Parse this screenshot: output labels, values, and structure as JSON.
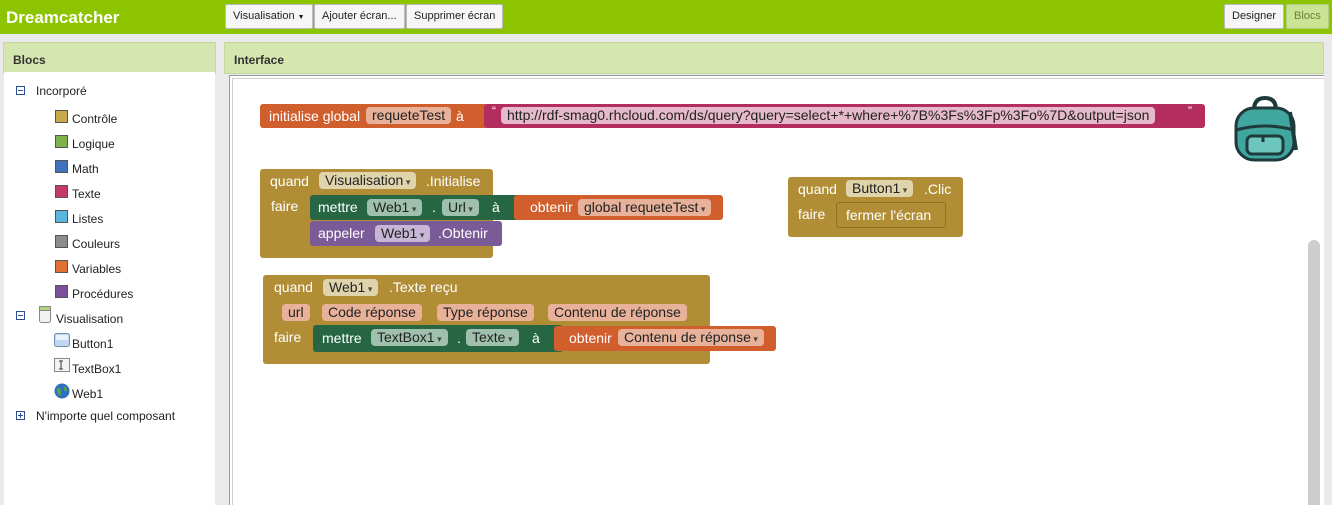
{
  "app": {
    "title": "Dreamcatcher"
  },
  "toolbar": {
    "screen_select": "Visualisation",
    "add_screen": "Ajouter écran...",
    "remove_screen": "Supprimer écran",
    "designer": "Designer",
    "blocks": "Blocs"
  },
  "left_panel": {
    "title": "Blocs",
    "builtin": {
      "label": "Incorporé",
      "items": [
        {
          "label": "Contrôle",
          "color": "#c9a84a"
        },
        {
          "label": "Logique",
          "color": "#7fb24a"
        },
        {
          "label": "Math",
          "color": "#3f73bd"
        },
        {
          "label": "Texte",
          "color": "#c2396a"
        },
        {
          "label": "Listes",
          "color": "#5ab6e0"
        },
        {
          "label": "Couleurs",
          "color": "#8c8c8c"
        },
        {
          "label": "Variables",
          "color": "#e07035"
        },
        {
          "label": "Procédures",
          "color": "#7b4f9a"
        }
      ]
    },
    "screen": {
      "label": "Visualisation",
      "components": [
        "Button1",
        "TextBox1",
        "Web1"
      ]
    },
    "any_component": "N'importe quel composant"
  },
  "workspace": {
    "title": "Interface",
    "global_block": {
      "init": "initialise global",
      "name": "requeteTest",
      "to": "à",
      "quote_open": "“",
      "value": "http://rdf-smag0.rhcloud.com/ds/query?query=select+*+where+%7B%3Fs%3Fp%3Fo%7D&output=json",
      "quote_close": "”"
    },
    "event_init": {
      "when": "quand",
      "component": "Visualisation",
      "event": ".Initialise",
      "do": "faire",
      "set": "mettre",
      "set_component": "Web1",
      "dot": ".",
      "property": "Url",
      "to": "à",
      "get": "obtenir",
      "get_var": "global requeteTest",
      "call": "appeler",
      "call_component": "Web1",
      "method": ".Obtenir"
    },
    "event_click": {
      "when": "quand",
      "component": "Button1",
      "event": ".Clic",
      "do": "faire",
      "action": "fermer l'écran"
    },
    "event_text": {
      "when": "quand",
      "component": "Web1",
      "event": ".Texte reçu",
      "params": [
        "url",
        "Code réponse",
        "Type réponse",
        "Contenu de réponse"
      ],
      "do": "faire",
      "set": "mettre",
      "set_component": "TextBox1",
      "dot": ".",
      "property": "Texte",
      "to": "à",
      "get": "obtenir",
      "get_var": "Contenu de réponse"
    },
    "backpack_icon": "backpack-icon"
  }
}
